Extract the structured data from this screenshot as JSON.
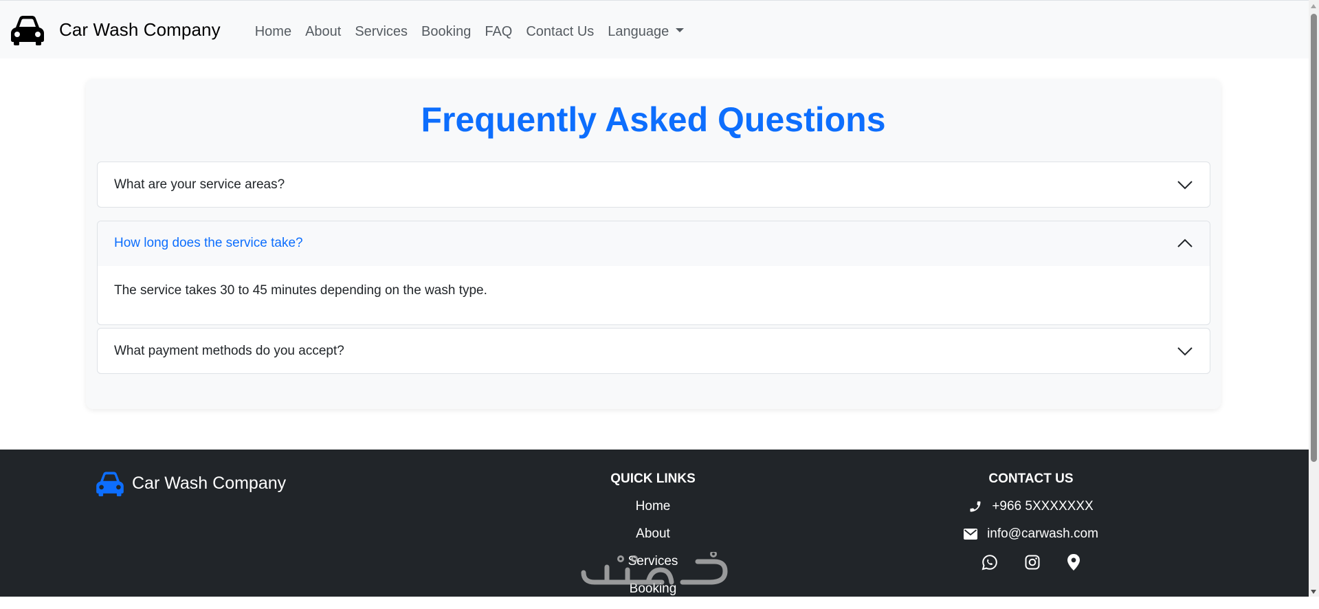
{
  "navbar": {
    "brand": "Car Wash Company",
    "links": [
      "Home",
      "About",
      "Services",
      "Booking",
      "FAQ",
      "Contact Us"
    ],
    "language_label": "Language"
  },
  "faq": {
    "title": "Frequently Asked Questions",
    "items": [
      {
        "question": "What are your service areas?",
        "expanded": false
      },
      {
        "question": "How long does the service take?",
        "answer": "The service takes 30 to 45 minutes depending on the wash type.",
        "expanded": true
      },
      {
        "question": "What payment methods do you accept?",
        "expanded": false
      }
    ]
  },
  "footer": {
    "brand": "Car Wash Company",
    "quick_links_heading": "QUICK LINKS",
    "quick_links": [
      "Home",
      "About",
      "Services",
      "Booking"
    ],
    "contact_heading": "CONTACT US",
    "phone": "+966 5XXXXXXX",
    "email": "info@carwash.com",
    "social_icons": [
      "whatsapp-icon",
      "instagram-icon",
      "location-pin-icon"
    ]
  },
  "colors": {
    "accent": "#0d6efd",
    "navbar_bg": "#f8f9fa",
    "footer_bg": "#212529"
  }
}
